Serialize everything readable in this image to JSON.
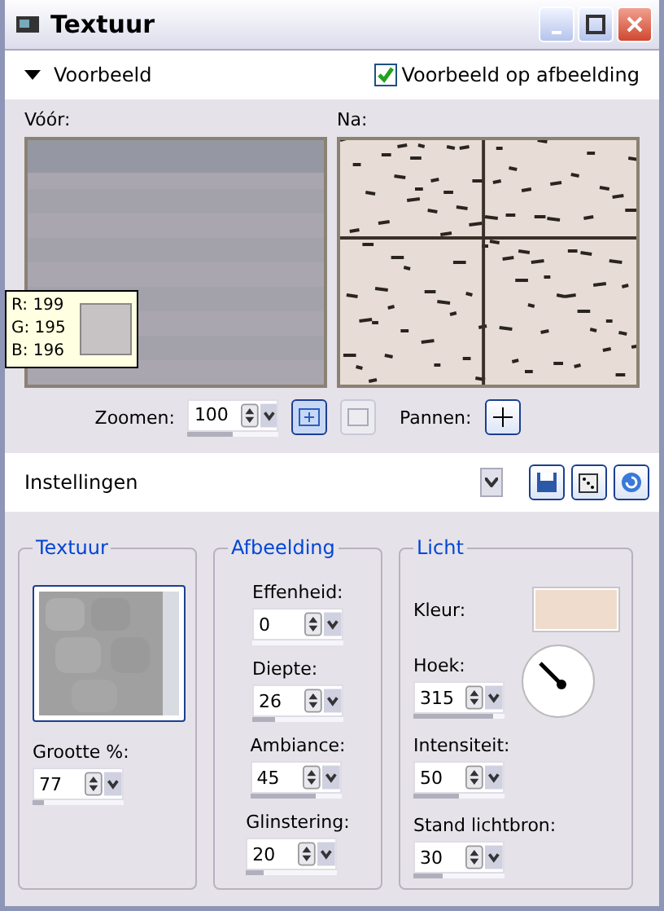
{
  "window": {
    "title": "Textuur"
  },
  "preview": {
    "label": "Voorbeeld",
    "expanded": true,
    "on_image": {
      "label": "Voorbeeld op afbeelding",
      "checked": true
    },
    "before_label": "Vóór:",
    "after_label": "Na:",
    "pixel_info": {
      "lines": [
        "R: 199",
        "G: 195",
        "B: 196"
      ],
      "color": "#c7c3c4"
    },
    "zoom": {
      "label": "Zoomen:",
      "value": "100",
      "level": 0.5,
      "fit_selected": true,
      "actual_size_disabled": true
    },
    "pan": {
      "label": "Pannen:"
    }
  },
  "settings": {
    "label": "Instellingen"
  },
  "groups": [
    {
      "title": "Textuur",
      "kind": "texture",
      "fields": [
        {
          "label": "Grootte %:",
          "value": "77",
          "level": 0.12
        }
      ]
    },
    {
      "title": "Afbeelding",
      "kind": "fields",
      "fields": [
        {
          "label": "Effenheid:",
          "value": "0",
          "level": 0
        },
        {
          "label": "Diepte:",
          "value": "26",
          "level": 0.25
        },
        {
          "label": "Ambiance:",
          "value": "45",
          "level": 0.72
        },
        {
          "label": "Glinstering:",
          "value": "20",
          "level": 0.2
        }
      ]
    },
    {
      "title": "Licht",
      "kind": "light",
      "color_label": "Kleur:",
      "color": "#efdccc",
      "fields": [
        {
          "label": "Hoek:",
          "value": "315",
          "level": 0.88
        },
        {
          "label": "Intensiteit:",
          "value": "50",
          "level": 0.5
        },
        {
          "label": "Stand lichtbron:",
          "value": "30",
          "level": 0.32
        }
      ]
    }
  ]
}
